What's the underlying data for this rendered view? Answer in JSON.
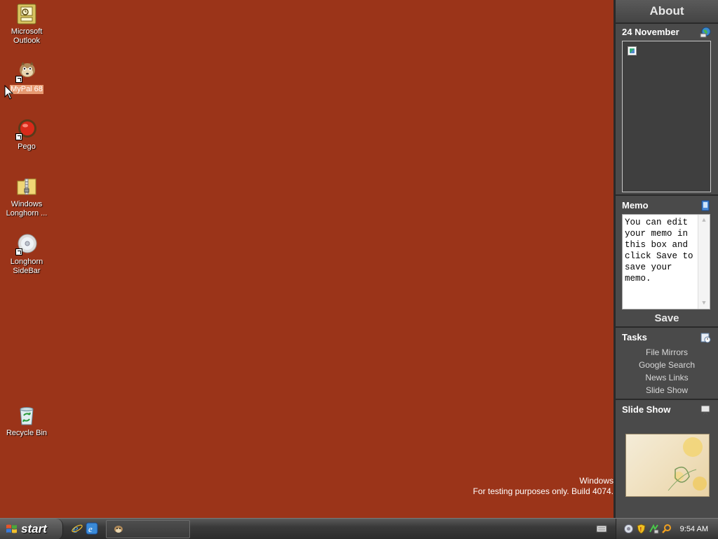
{
  "desktop": {
    "icons": [
      {
        "label_line1": "Microsoft",
        "label_line2": "Outlook",
        "icon": "outlook-icon"
      },
      {
        "label_line1": "MyPal 68",
        "icon": "mypal-icon"
      },
      {
        "label_line1": "Pego",
        "icon": "pego-icon"
      },
      {
        "label_line1": "Windows",
        "label_line2": "Longhorn ...",
        "icon": "zip-folder-icon"
      },
      {
        "label_line1": "Longhorn",
        "label_line2": "SideBar",
        "icon": "sidebar-icon"
      },
      {
        "label_line1": "Recycle Bin",
        "icon": "recycle-bin-icon"
      }
    ],
    "watermark_line1": "Windows",
    "watermark_line2": "For testing purposes only. Build 4074."
  },
  "sidebar": {
    "about_label": "About",
    "calendar": {
      "title": "24 November",
      "icon": "globe-icon"
    },
    "memo": {
      "title": "Memo",
      "icon": "memo-icon",
      "text": "You can edit your memo in this box and click Save to save your memo.",
      "save_label": "Save"
    },
    "tasks": {
      "title": "Tasks",
      "icon": "tasks-icon",
      "items": [
        "File Mirrors",
        "Google Search",
        "News Links",
        "Slide Show"
      ]
    },
    "slideshow": {
      "title": "Slide Show",
      "icon": "slideshow-icon"
    }
  },
  "taskbar": {
    "start_label": "start",
    "clock": "9:54 AM"
  },
  "colors": {
    "desktop": "#9b3419",
    "sidebar": "#4a4a4a",
    "taskbar": "#3a3a3a",
    "selection": "#e79a72"
  }
}
